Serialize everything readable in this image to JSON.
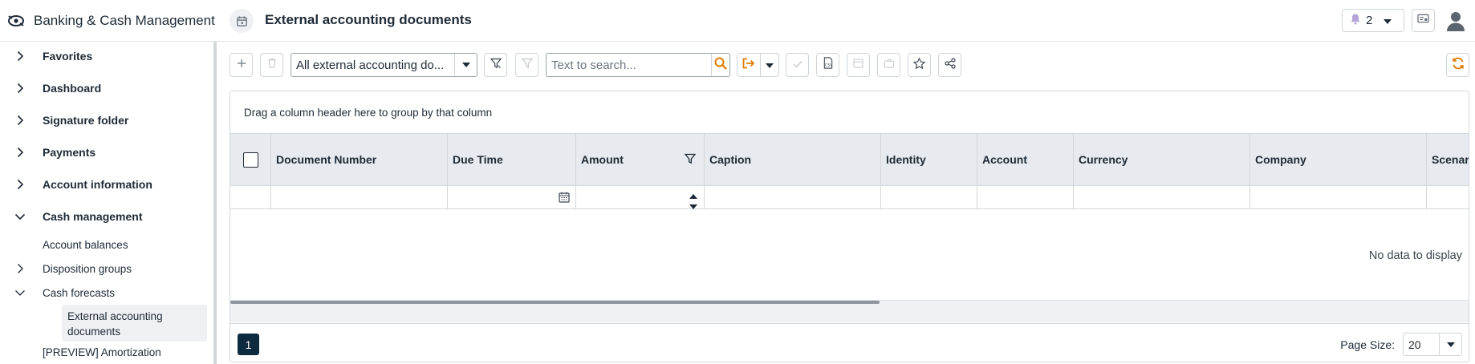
{
  "app": {
    "title": "Banking & Cash Management"
  },
  "page": {
    "title": "External accounting documents"
  },
  "header": {
    "notification_count": "2"
  },
  "sidebar": {
    "items": [
      {
        "label": "Favorites"
      },
      {
        "label": "Dashboard"
      },
      {
        "label": "Signature folder"
      },
      {
        "label": "Payments"
      },
      {
        "label": "Account information"
      },
      {
        "label": "Cash management"
      }
    ],
    "sub_items": [
      {
        "label": "Account balances"
      },
      {
        "label": "Disposition groups"
      },
      {
        "label": "Cash forecasts"
      }
    ],
    "active_item": "External accounting documents",
    "preview_item": "[PREVIEW] Amortization"
  },
  "toolbar": {
    "view_select_value": "All external accounting do...",
    "search_placeholder": "Text to search..."
  },
  "grid": {
    "group_panel_text": "Drag a column header here to group by that column",
    "columns": [
      "Document Number",
      "Due Time",
      "Amount",
      "Caption",
      "Identity",
      "Account",
      "Currency",
      "Company",
      "Scenari"
    ],
    "empty_text": "No data to display"
  },
  "pager": {
    "current_page": "1",
    "page_size_label": "Page Size:",
    "page_size": "20"
  },
  "colors": {
    "accent": "#e07b00",
    "primary_dark": "#0e2a3f",
    "header_bg": "#e7eaee"
  }
}
